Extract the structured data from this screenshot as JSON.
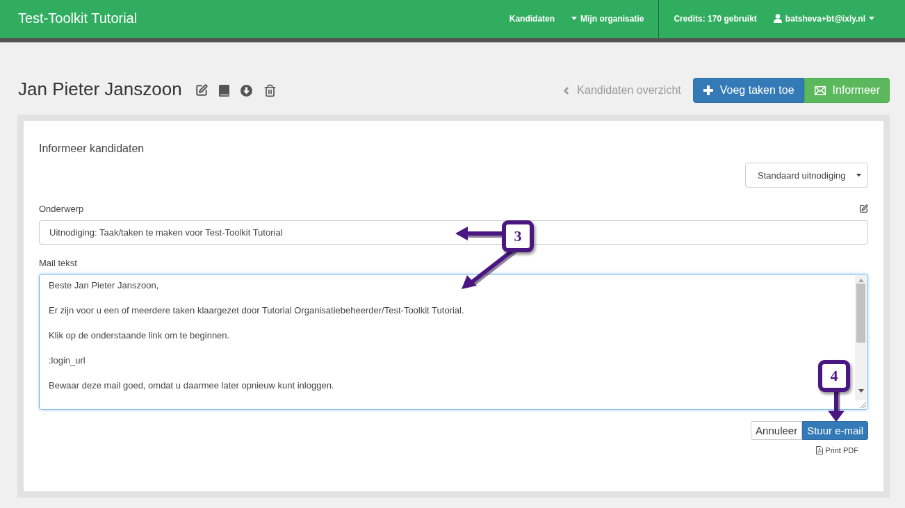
{
  "navbar": {
    "brand": "Test-Toolkit Tutorial",
    "links": [
      {
        "label": "Kandidaten",
        "kind": "link"
      },
      {
        "label": "Mijn organisatie",
        "kind": "dropdown"
      }
    ],
    "credits": "Credits: 170 gebruikt",
    "user": "batsheva+bt@ixly.nl"
  },
  "header": {
    "title": "Jan Pieter Janszoon",
    "back_link": "Kandidaten overzicht",
    "buttons": [
      {
        "label": "Voeg taken toe",
        "kind": "primary"
      },
      {
        "label": "Informeer",
        "kind": "success"
      }
    ]
  },
  "form": {
    "title": "Informeer kandidaten",
    "template_select": {
      "value": "Standaard uitnodiging"
    },
    "subject": {
      "label": "Onderwerp",
      "value": "Uitnodiging: Taak/taken te maken voor Test-Toolkit Tutorial"
    },
    "mail_text": {
      "label": "Mail tekst",
      "focused": true,
      "paragraphs": [
        "Beste Jan Pieter Janszoon,",
        "Er zijn voor u een of meerdere taken klaargezet door Tutorial Organisatiebeheerder/Test-Toolkit Tutorial.",
        "Klik op de onderstaande link om te beginnen.",
        ":login_url",
        "Bewaar deze mail goed, omdat u daarmee later opnieuw kunt inloggen."
      ]
    },
    "buttons": [
      {
        "label": "Annuleer",
        "kind": "default"
      },
      {
        "label": "Stuur e-mail",
        "kind": "primary"
      }
    ],
    "print_link": "Print PDF"
  },
  "annotations": [
    {
      "label": "3"
    },
    {
      "label": "4"
    }
  ]
}
